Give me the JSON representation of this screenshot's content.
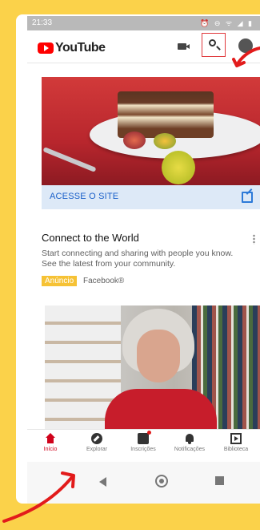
{
  "status_bar": {
    "time": "21:33",
    "icons": "⏰ ⊖ ᯤ ◢ ▮"
  },
  "app_bar": {
    "logo_text": "YouTube",
    "icons": [
      "video-camera-icon",
      "search-icon",
      "account-avatar-icon"
    ]
  },
  "ad_card": {
    "cta_label": "ACESSE O SITE",
    "title": "Connect to the World",
    "description": "Start connecting and sharing with people you know. See the latest from your community.",
    "badge": "Anúncio",
    "source": "Facebook®"
  },
  "bottom_nav": {
    "items": [
      {
        "label": "Início",
        "icon": "home-icon",
        "active": true
      },
      {
        "label": "Explorar",
        "icon": "compass-icon",
        "active": false
      },
      {
        "label": "Inscrições",
        "icon": "subscriptions-icon",
        "active": false
      },
      {
        "label": "Notificações",
        "icon": "bell-icon",
        "active": false
      },
      {
        "label": "Biblioteca",
        "icon": "library-icon",
        "active": false
      }
    ]
  },
  "system_nav": [
    "back-icon",
    "home-button-icon",
    "recents-icon"
  ],
  "colors": {
    "background": "#fbd24a",
    "accent_red": "#ff0000",
    "annotation_red": "#e0383b",
    "cta_text": "#1a60c9",
    "cta_background": "#dde9f7",
    "ad_badge": "#f6c235"
  }
}
